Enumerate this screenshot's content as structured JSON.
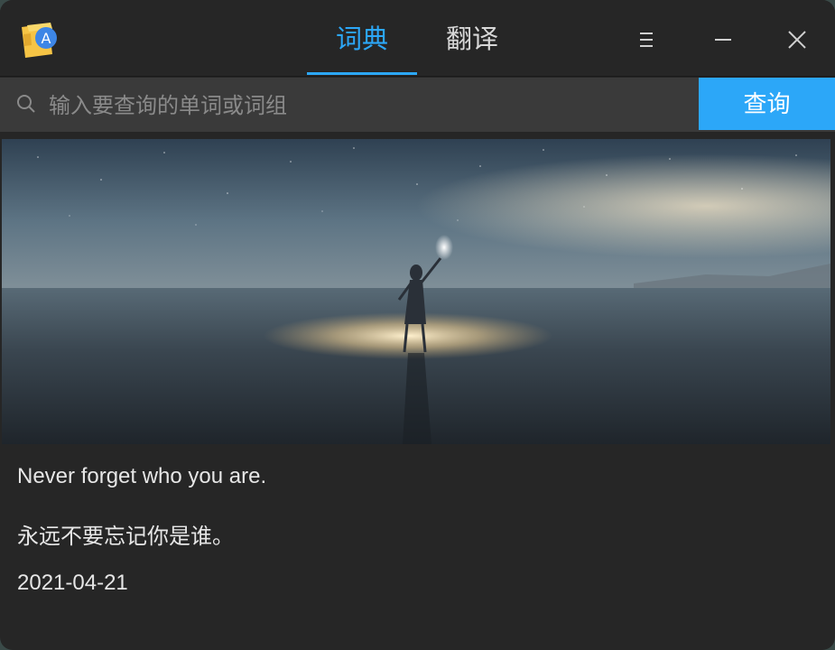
{
  "window": {
    "background": "#262626",
    "accent": "#2ca7f8"
  },
  "app": {
    "icon": "dictionary-app-icon",
    "icon_letter": "A"
  },
  "tabs": [
    {
      "label": "词典",
      "active": true
    },
    {
      "label": "翻译",
      "active": false
    }
  ],
  "window_controls": {
    "menu": "menu-icon",
    "minimize": "minimize-icon",
    "close": "close-icon"
  },
  "search": {
    "placeholder": "输入要查询的单词或词组",
    "value": "",
    "button_label": "查询"
  },
  "daily": {
    "image_subject": "woman-with-torch-on-beach-under-starry-sky",
    "quote_en": "Never forget who you are.",
    "quote_zh": "永远不要忘记你是谁。",
    "date": "2021-04-21"
  }
}
